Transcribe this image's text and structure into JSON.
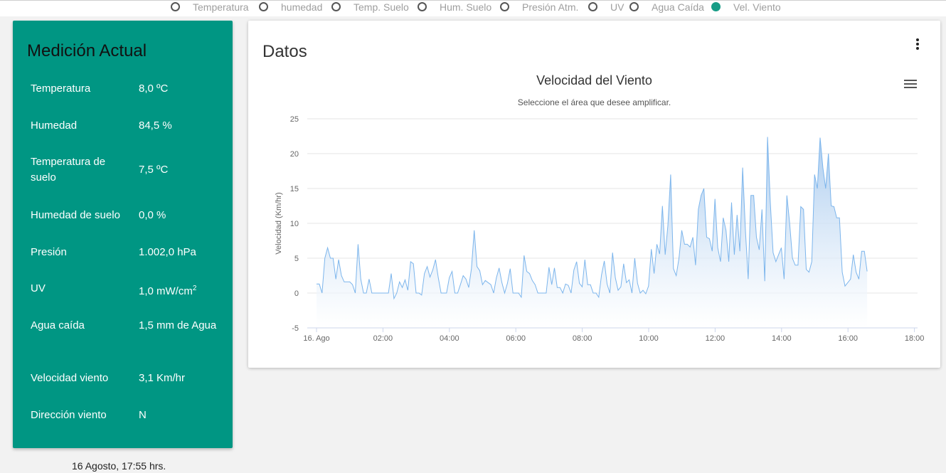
{
  "top_toggles": [
    {
      "label": "Temperatura",
      "checked": false
    },
    {
      "label": "humedad",
      "checked": false
    },
    {
      "label": "Temp. Suelo",
      "checked": false
    },
    {
      "label": "Hum. Suelo",
      "checked": false
    },
    {
      "label": "Presión Atm.",
      "checked": false
    },
    {
      "label": "UV",
      "checked": false
    },
    {
      "label": "Agua Caída",
      "checked": false
    },
    {
      "label": "Vel. Viento",
      "checked": true
    }
  ],
  "current": {
    "title": "Medición Actual",
    "rows": [
      {
        "label": "Temperatura",
        "value": "8,0 ºC"
      },
      {
        "label": "Humedad",
        "value": "84,5 %"
      },
      {
        "label": "Temperatura de suelo",
        "value": "7,5 ºC"
      },
      {
        "label": "Humedad de suelo",
        "value": "0,0 %"
      },
      {
        "label": "Presión",
        "value": "1.002,0 hPa"
      },
      {
        "label": "UV",
        "value": "1,0 mW/cm",
        "sup": "2"
      },
      {
        "label": "Agua caída",
        "value": "1,5 mm de Agua"
      },
      {
        "label": "Velocidad viento",
        "value": "3,1 Km/hr"
      },
      {
        "label": "Dirección viento",
        "value": "N"
      }
    ],
    "timestamp": "16 Agosto, 17:55 hrs."
  },
  "panel": {
    "title": "Datos"
  },
  "chart_data": {
    "type": "area",
    "title": "Velocidad del Viento",
    "subtitle": "Seleccione el área que desee amplificar.",
    "ylabel": "Velocidad (Km/hr)",
    "ylim": [
      -5,
      25
    ],
    "yticks": [
      -5,
      0,
      5,
      10,
      15,
      20,
      25
    ],
    "xlim": [
      "00:00",
      "18:10"
    ],
    "xtick_labels": [
      "16. Ago",
      "02:00",
      "04:00",
      "06:00",
      "08:00",
      "10:00",
      "12:00",
      "14:00",
      "16:00",
      "18:00"
    ],
    "grid": true,
    "colors": {
      "line": "#7cb5ec",
      "fill_top": "#a6c9ee",
      "fill_bottom": "#ffffff"
    },
    "series": [
      {
        "x_start_hours": 0,
        "x_step_hours": 0.0833,
        "values": [
          1.3,
          1.3,
          0,
          5,
          6.5,
          5,
          5,
          2,
          4.8,
          2.5,
          1.6,
          1.6,
          1.6,
          1.2,
          0,
          7,
          2,
          0,
          0,
          2,
          0,
          0,
          0,
          0,
          0,
          0,
          0,
          2.8,
          -0.8,
          0,
          1.6,
          0.8,
          1.9,
          0.4,
          4.5,
          4.2,
          0,
          0,
          -0.3,
          2.8,
          3.8,
          2.3,
          3.3,
          4.8,
          2.2,
          0,
          0,
          0,
          2.2,
          3.1,
          0,
          0,
          1.2,
          2.5,
          2,
          0.8,
          3.5,
          9,
          3.8,
          3.2,
          1.2,
          1.8,
          1.5,
          1.2,
          0,
          2.2,
          3.6,
          1.5,
          0,
          1.4,
          3.5,
          0,
          0,
          0,
          -0.6,
          5.4,
          3.1,
          2.8,
          1.8,
          1.2,
          0,
          0,
          0,
          0,
          3.7,
          1.2,
          3.6,
          0.8,
          0.8,
          0,
          1.3,
          1.1,
          0,
          3.3,
          4.5,
          1.4,
          0.9,
          4.8,
          1.2,
          1.2,
          0,
          0,
          -0.6,
          2.6,
          4.6,
          1.3,
          0,
          5.8,
          2.2,
          0.4,
          0.9,
          4.2,
          1.5,
          1.9,
          0,
          5,
          1.4,
          0,
          0.4,
          -0.1,
          1,
          6.3,
          2.8,
          7,
          5.6,
          12.5,
          5.5,
          9.7,
          17,
          3.5,
          2.5,
          5,
          9,
          7,
          7,
          6.6,
          8,
          4,
          12,
          14,
          15,
          8,
          7.8,
          6,
          13.5,
          6.5,
          4.5,
          10.8,
          9,
          4.5,
          13,
          5.5,
          11.2,
          6,
          18,
          9,
          2,
          14,
          14,
          8,
          6.2,
          12,
          1.7,
          22.4,
          13,
          5.8,
          4.5,
          5.5,
          6.5,
          2,
          14,
          10,
          5,
          4,
          4,
          12.4,
          12,
          3.4,
          3,
          4.5,
          17,
          15,
          22.3,
          18,
          15,
          20,
          12.5,
          12.4,
          10.8,
          10.8,
          3,
          1,
          1.5,
          2,
          5.5,
          3,
          2,
          6,
          6,
          3.1
        ]
      }
    ]
  }
}
